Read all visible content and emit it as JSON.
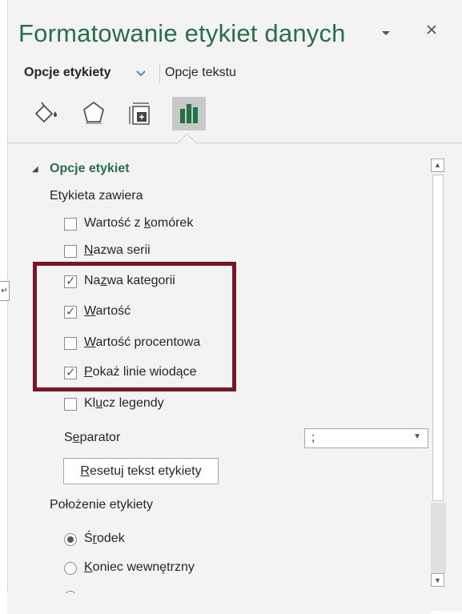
{
  "pane": {
    "title": "Formatowanie etykiet danych",
    "title_dropdown_icon": "chevron-down-icon",
    "close_icon": "close-icon"
  },
  "tabs": [
    {
      "label": "Opcje etykiety",
      "selected": true
    },
    {
      "label": "Opcje tekstu",
      "selected": false
    }
  ],
  "icon_tabs": [
    "fill-line-icon",
    "effects-pentagon-icon",
    "size-properties-icon",
    "bar-chart-options-icon"
  ],
  "section": {
    "title": "Opcje etykiet",
    "contains_label": "Etykieta zawiera",
    "checkboxes": [
      {
        "pre": "Wartość z ",
        "ul": "k",
        "post": "omórek",
        "checked": false
      },
      {
        "pre": "",
        "ul": "N",
        "post": "azwa serii",
        "checked": false
      },
      {
        "pre": "Na",
        "ul": "z",
        "post": "wa kategorii",
        "checked": true
      },
      {
        "pre": "",
        "ul": "W",
        "post": "artość",
        "checked": true
      },
      {
        "pre": "",
        "ul": "W",
        "post": "artość procentowa",
        "checked": false
      },
      {
        "pre": "",
        "ul": "P",
        "post": "okaż linie wiodące",
        "checked": true
      },
      {
        "pre": "Kl",
        "ul": "u",
        "post": "cz legendy",
        "checked": false
      }
    ],
    "separator": {
      "pre": "S",
      "ul": "e",
      "post": "parator",
      "value": ";"
    },
    "reset_button": {
      "pre": "",
      "ul": "R",
      "post": "esetuj tekst etykiety"
    },
    "position_label": "Położenie etykiety",
    "radios": [
      {
        "pre": "Ś",
        "ul": "r",
        "post": "odek",
        "selected": true
      },
      {
        "pre": "",
        "ul": "K",
        "post": "oniec wewnętrzny",
        "selected": false
      }
    ]
  },
  "colors": {
    "accent": "#2a6e4b",
    "highlight_box": "#7a1525",
    "pane_bg": "#f3f3f3"
  }
}
